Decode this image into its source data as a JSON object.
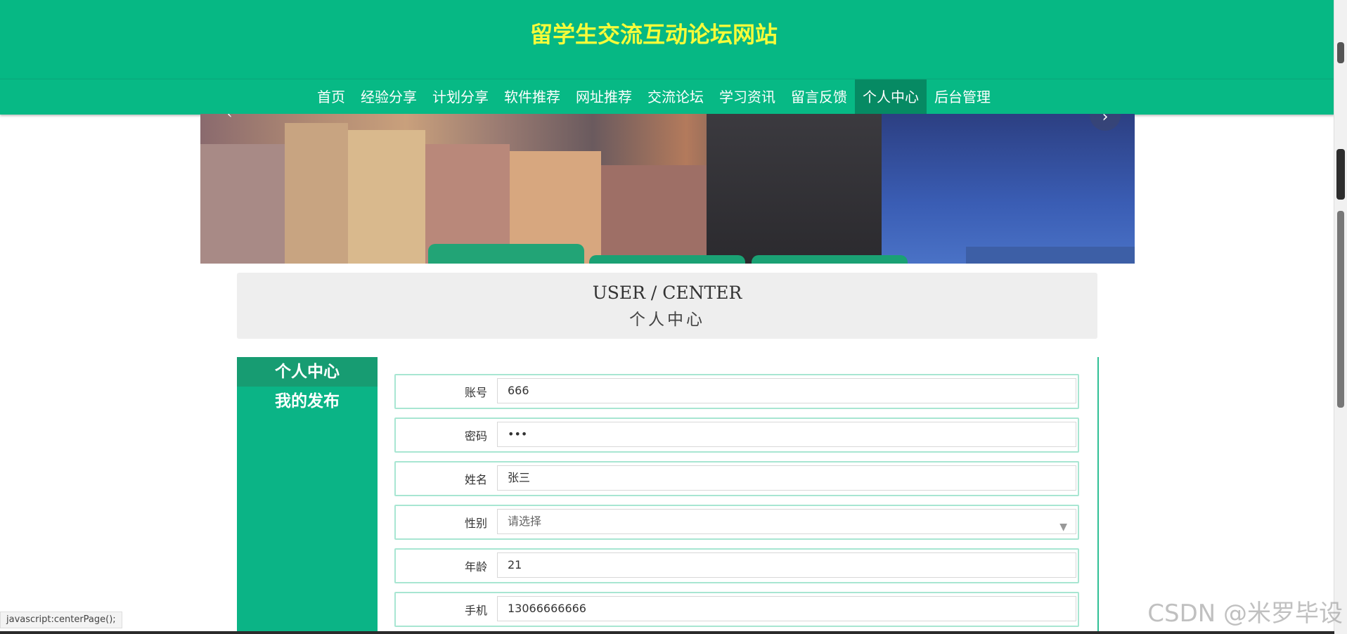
{
  "header": {
    "site_title": "留学生交流互动论坛网站"
  },
  "nav": {
    "items": [
      {
        "label": "首页"
      },
      {
        "label": "经验分享"
      },
      {
        "label": "计划分享"
      },
      {
        "label": "软件推荐"
      },
      {
        "label": "网址推荐"
      },
      {
        "label": "交流论坛"
      },
      {
        "label": "学习资讯"
      },
      {
        "label": "留言反馈"
      },
      {
        "label": "个人中心",
        "active": true
      },
      {
        "label": "后台管理"
      }
    ]
  },
  "page_title": {
    "en": "USER / CENTER",
    "zh": "个人中心"
  },
  "sidebar": {
    "items": [
      {
        "label": "个人中心",
        "active": true
      },
      {
        "label": "我的发布"
      }
    ]
  },
  "form": {
    "account": {
      "label": "账号",
      "value": "666"
    },
    "password": {
      "label": "密码",
      "value": "•••"
    },
    "name": {
      "label": "姓名",
      "value": "张三"
    },
    "gender": {
      "label": "性别",
      "placeholder": "请选择"
    },
    "age": {
      "label": "年龄",
      "value": "21"
    },
    "phone": {
      "label": "手机",
      "value": "13066666666"
    }
  },
  "status_bar": {
    "text": "javascript:centerPage();"
  },
  "watermark": {
    "text": "CSDN @米罗毕设"
  },
  "colors": {
    "primary": "#06b884",
    "title_yellow": "#f6fb3a",
    "active_nav": "#068a63"
  }
}
